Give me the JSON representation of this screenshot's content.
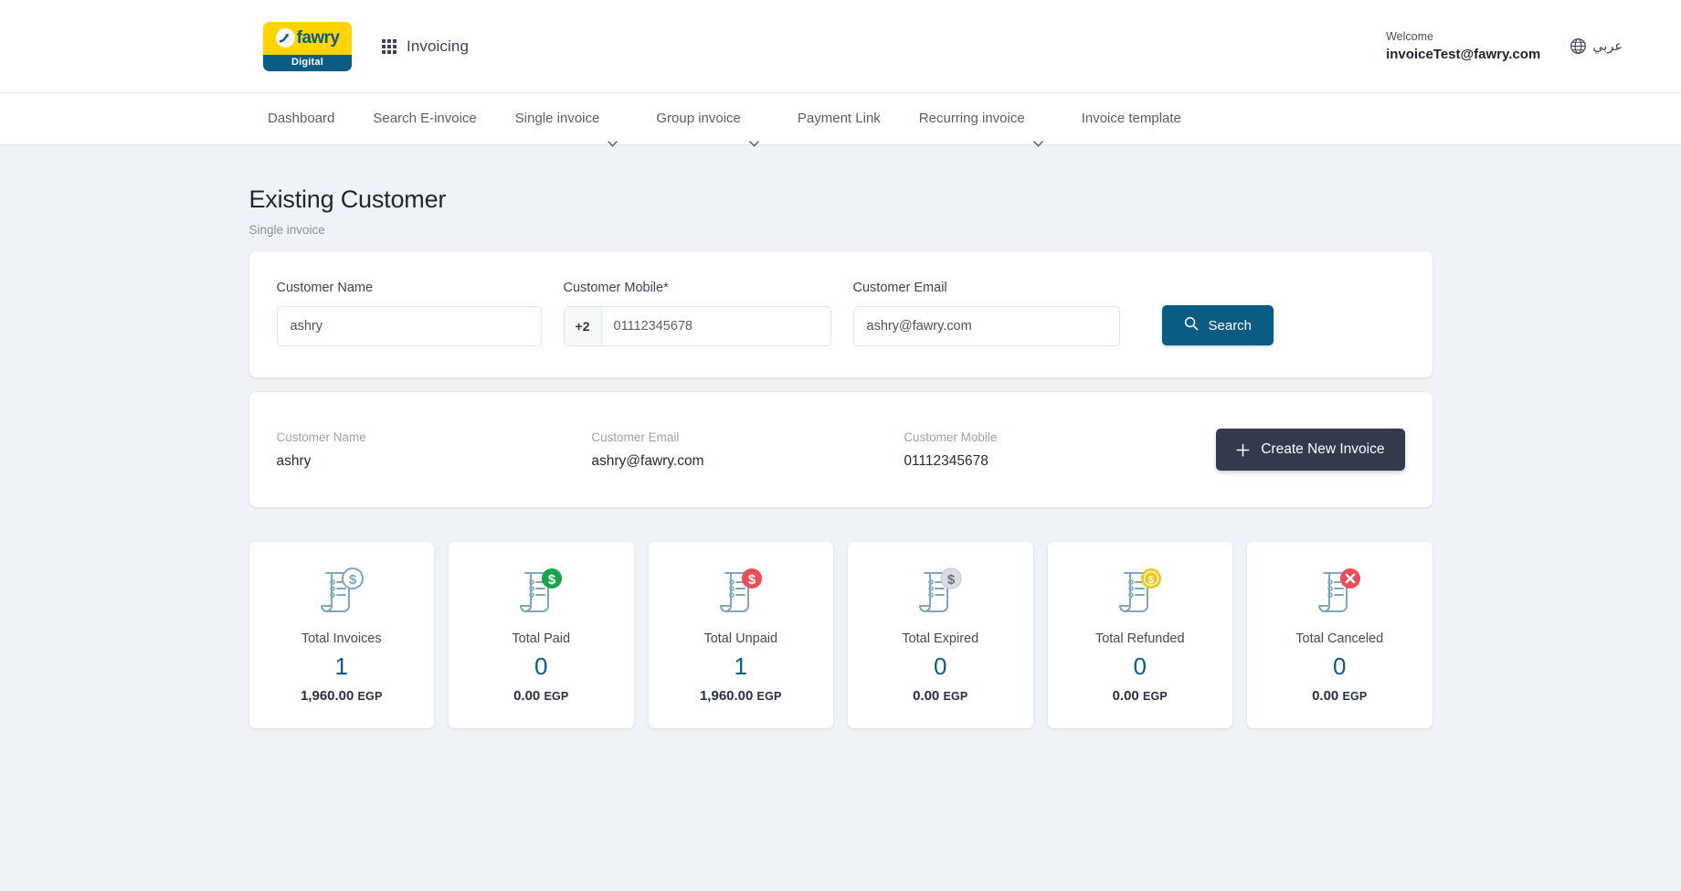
{
  "header": {
    "logo": {
      "brand": "fawry",
      "sub": "Digital",
      "mark_icon": "fawry-arrow-icon"
    },
    "apps_icon": "apps-grid-icon",
    "app_title": "Invoicing",
    "welcome_label": "Welcome",
    "welcome_user": "invoiceTest@fawry.com",
    "globe_icon": "globe-icon",
    "lang_label": "عربي"
  },
  "nav": {
    "items": [
      {
        "label": "Dashboard",
        "has_caret": false
      },
      {
        "label": "Search E-invoice",
        "has_caret": false
      },
      {
        "label": "Single invoice",
        "has_caret": true
      },
      {
        "label": "Group invoice",
        "has_caret": true
      },
      {
        "label": "Payment Link",
        "has_caret": false
      },
      {
        "label": "Recurring invoice",
        "has_caret": true
      },
      {
        "label": "Invoice template",
        "has_caret": false
      }
    ]
  },
  "page": {
    "title": "Existing Customer",
    "subtitle": "Single invoice"
  },
  "search_form": {
    "name_label": "Customer Name",
    "name_value": "ashry",
    "name_placeholder": "Customer Name",
    "mobile_label": "Customer Mobile*",
    "mobile_prefix": "+2",
    "mobile_value": "01112345678",
    "mobile_placeholder": "01112345678",
    "email_label": "Customer Email",
    "email_value": "ashry@fawry.com",
    "email_placeholder": "Customer Email",
    "search_button": "Search",
    "search_icon": "search-icon",
    "accent_color": "#0b5c85"
  },
  "customer": {
    "name_label": "Customer Name",
    "name_value": "ashry",
    "email_label": "Customer Email",
    "email_value": "ashry@fawry.com",
    "mobile_label": "Customer Mobile",
    "mobile_value": "01112345678",
    "create_button": "Create New Invoice",
    "create_icon": "plus-icon",
    "create_color": "#343a4d"
  },
  "stats": [
    {
      "title": "Total Invoices",
      "count": "1",
      "amount": "1,960.00",
      "currency": "EGP",
      "icon": "invoice-dollar-outline-icon",
      "badge_color": "none"
    },
    {
      "title": "Total Paid",
      "count": "0",
      "amount": "0.00",
      "currency": "EGP",
      "icon": "invoice-paid-icon",
      "badge_color": "#17a44a"
    },
    {
      "title": "Total Unpaid",
      "count": "1",
      "amount": "1,960.00",
      "currency": "EGP",
      "icon": "invoice-unpaid-icon",
      "badge_color": "#eb4d54"
    },
    {
      "title": "Total Expired",
      "count": "0",
      "amount": "0.00",
      "currency": "EGP",
      "icon": "invoice-expired-icon",
      "badge_color": "#d4d7dc"
    },
    {
      "title": "Total Refunded",
      "count": "0",
      "amount": "0.00",
      "currency": "EGP",
      "icon": "invoice-refunded-icon",
      "badge_color": "#f5c518"
    },
    {
      "title": "Total Canceled",
      "count": "0",
      "amount": "0.00",
      "currency": "EGP",
      "icon": "invoice-canceled-icon",
      "badge_color": "#eb4d54"
    }
  ],
  "theme": {
    "page_bg": "#eff2f6",
    "card_bg": "#ffffff",
    "brand_yellow": "#ffd400",
    "brand_blue": "#0b5c85",
    "icon_outline": "#7fa6c0"
  }
}
